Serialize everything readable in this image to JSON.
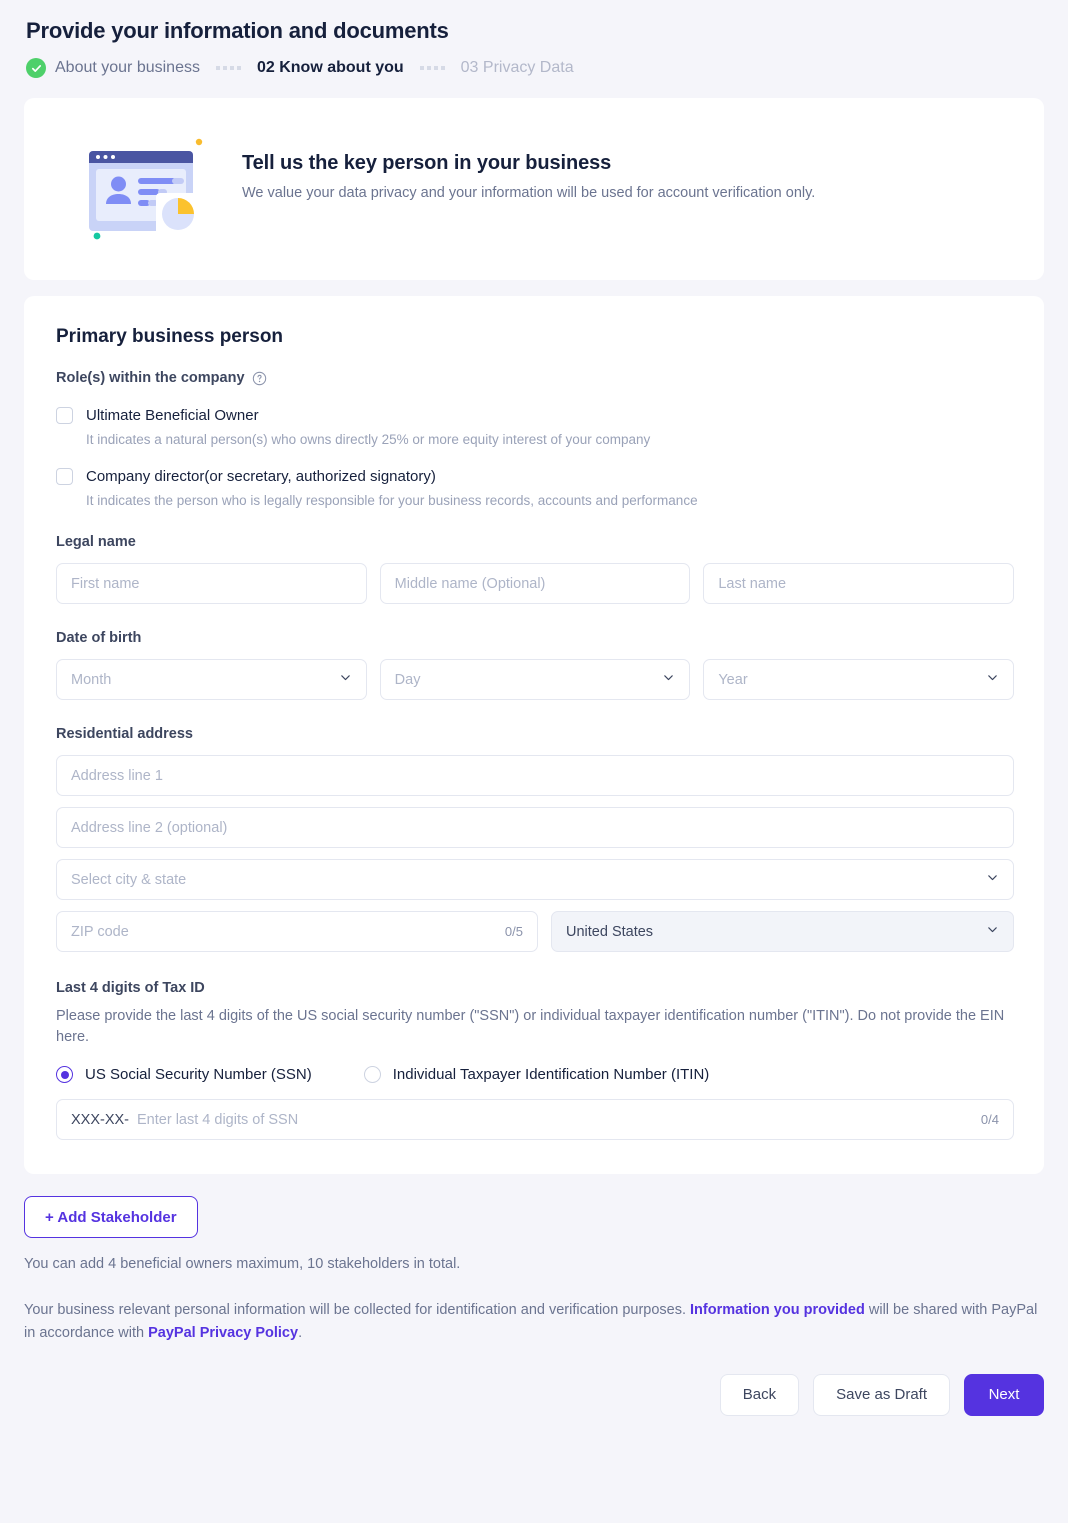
{
  "page_title": "Provide your information and documents",
  "stepper": {
    "steps": [
      {
        "label": "About your business",
        "state": "done",
        "icon": "check-circle-icon"
      },
      {
        "label": "02 Know about you",
        "state": "current"
      },
      {
        "label": "03 Privacy Data",
        "state": "upcoming"
      }
    ]
  },
  "intro": {
    "illustration": "id-card-browser-illustration",
    "title": "Tell us the key person in your business",
    "subtitle": "We value your data privacy and your information will be used for account verification only."
  },
  "form": {
    "section_title": "Primary business person",
    "roles": {
      "label": "Role(s) within the company",
      "help_icon": "question-circle-icon",
      "options": [
        {
          "label": "Ultimate Beneficial Owner",
          "hint": "It indicates a natural person(s) who owns directly 25% or more equity interest of your company",
          "checked": false
        },
        {
          "label": "Company director(or secretary, authorized signatory)",
          "hint": "It indicates the person who is legally responsible for your business records, accounts and performance",
          "checked": false
        }
      ]
    },
    "legal_name": {
      "label": "Legal name",
      "first_placeholder": "First name",
      "middle_placeholder": "Middle name (Optional)",
      "last_placeholder": "Last name"
    },
    "date_of_birth": {
      "label": "Date of birth",
      "month_placeholder": "Month",
      "day_placeholder": "Day",
      "year_placeholder": "Year"
    },
    "residential_address": {
      "label": "Residential address",
      "line1_placeholder": "Address line 1",
      "line2_placeholder": "Address line 2 (optional)",
      "city_state_placeholder": "Select city & state",
      "zip_placeholder": "ZIP code",
      "zip_counter": "0/5",
      "country_value": "United States"
    },
    "tax_id": {
      "label": "Last 4 digits of Tax ID",
      "description": "Please provide the last 4 digits of the US social security number (\"SSN\") or individual taxpayer identification number (\"ITIN\"). Do not provide the EIN here.",
      "options": [
        {
          "label": "US Social Security Number (SSN)",
          "selected": true
        },
        {
          "label": "Individual Taxpayer Identification Number (ITIN)",
          "selected": false
        }
      ],
      "input_prefix": "XXX-XX-",
      "input_placeholder": "Enter last 4 digits of SSN",
      "input_counter": "0/4"
    }
  },
  "footer": {
    "add_stakeholder_label": "+ Add Stakeholder",
    "add_hint": "You can add 4 beneficial owners maximum, 10 stakeholders in total.",
    "legal_part1": "Your business relevant personal information will be collected for identification and verification purposes. ",
    "legal_link1": "Information you provided",
    "legal_part2": " will be shared with PayPal in accordance with ",
    "legal_link2": "PayPal Privacy Policy",
    "legal_part3": ".",
    "buttons": {
      "back": "Back",
      "save_draft": "Save as Draft",
      "next": "Next"
    }
  },
  "colors": {
    "accent_purple": "#5533e0",
    "done_green": "#4ed06a",
    "page_bg": "#f5f5fa",
    "text_dark": "#16203c",
    "text_muted": "#6b7490"
  }
}
